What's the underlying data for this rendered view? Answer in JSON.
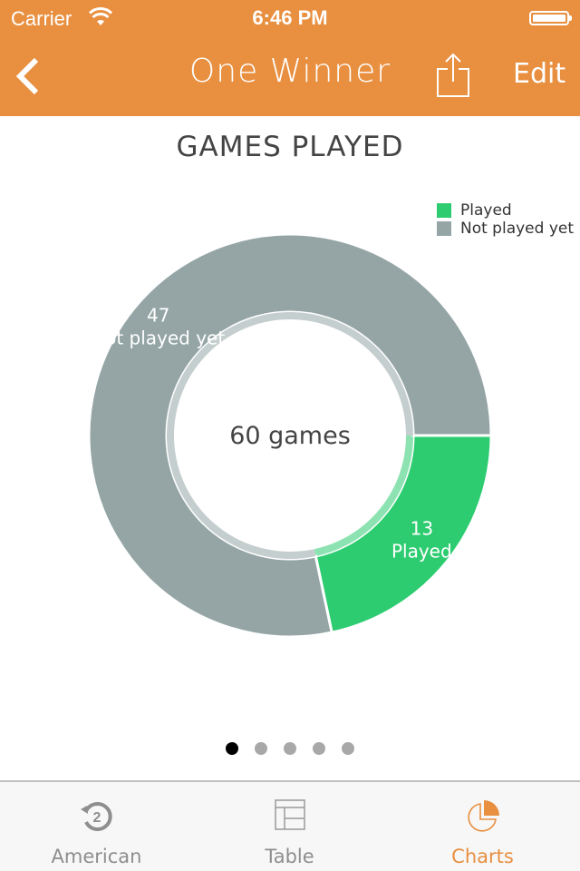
{
  "status_bar": {
    "carrier": "Carrier",
    "time": "6:46 PM",
    "icons": [
      "wifi-icon",
      "battery-icon"
    ]
  },
  "nav": {
    "title": "One Winner",
    "back_icon": "chevron-left-icon",
    "share_icon": "share-icon",
    "edit_label": "Edit"
  },
  "colors": {
    "accent": "#e88f40",
    "played": "#2ecc71",
    "not_played": "#95a5a6"
  },
  "chart_data": {
    "type": "pie",
    "style": "donut",
    "title": "GAMES PLAYED",
    "center_label": "60 games",
    "total": 60,
    "slices": [
      {
        "label": "Played",
        "value": 13,
        "display": [
          "13",
          "Played"
        ],
        "color": "#2ecc71"
      },
      {
        "label": "Not played yet",
        "value": 47,
        "display": [
          "47",
          "Not played yet"
        ],
        "color": "#95a5a6"
      }
    ],
    "legend": {
      "placement": "top-right",
      "entries": [
        "Played",
        "Not played yet"
      ]
    }
  },
  "pager": {
    "count": 5,
    "active": 0
  },
  "tabs": [
    {
      "label": "American",
      "icon": "replay-2-icon",
      "active": false
    },
    {
      "label": "Table",
      "icon": "table-icon",
      "active": false
    },
    {
      "label": "Charts",
      "icon": "pie-chart-icon",
      "active": true
    }
  ]
}
